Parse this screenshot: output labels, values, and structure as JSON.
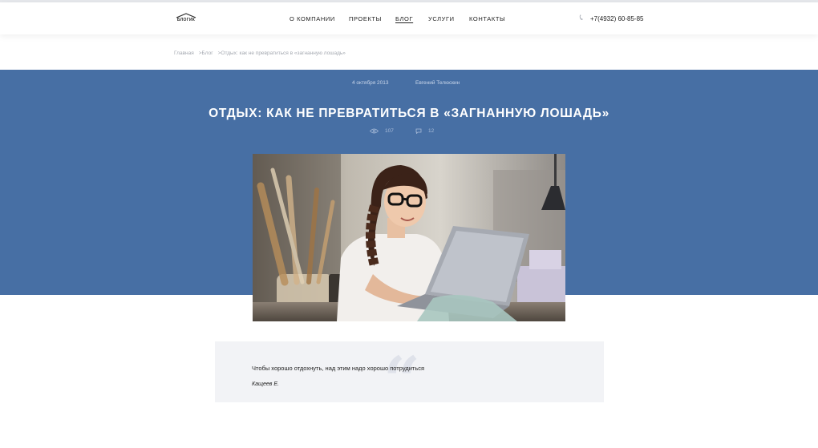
{
  "header": {
    "logo_text": "БЛОГИК",
    "nav": [
      {
        "label": "О компании",
        "active": false
      },
      {
        "label": "Проекты",
        "active": false
      },
      {
        "label": "Блог",
        "active": true
      },
      {
        "label": "Услуги",
        "active": false
      },
      {
        "label": "Контакты",
        "active": false
      }
    ],
    "phone": "+7(4932) 60-85-85"
  },
  "breadcrumb": {
    "home": "Главная",
    "blog": ">Блог",
    "current": ">Отдых: как не превратиться в «загнанную лошадь»"
  },
  "article": {
    "date": "4 октября 2013",
    "author": "Евгений Телюскин",
    "title": "ОТДЫХ: КАК НЕ ПРЕВРАТИТЬСЯ В «ЗАГНАННУЮ ЛОШАДЬ»",
    "views": "107",
    "comments": "12"
  },
  "quote": {
    "text": "Чтобы хорошо отдохнуть, над этим надо хорошо потрудиться",
    "author": "Кащеев Е."
  },
  "colors": {
    "hero_bg": "#476fa4",
    "quote_bg": "#f2f3f6"
  }
}
